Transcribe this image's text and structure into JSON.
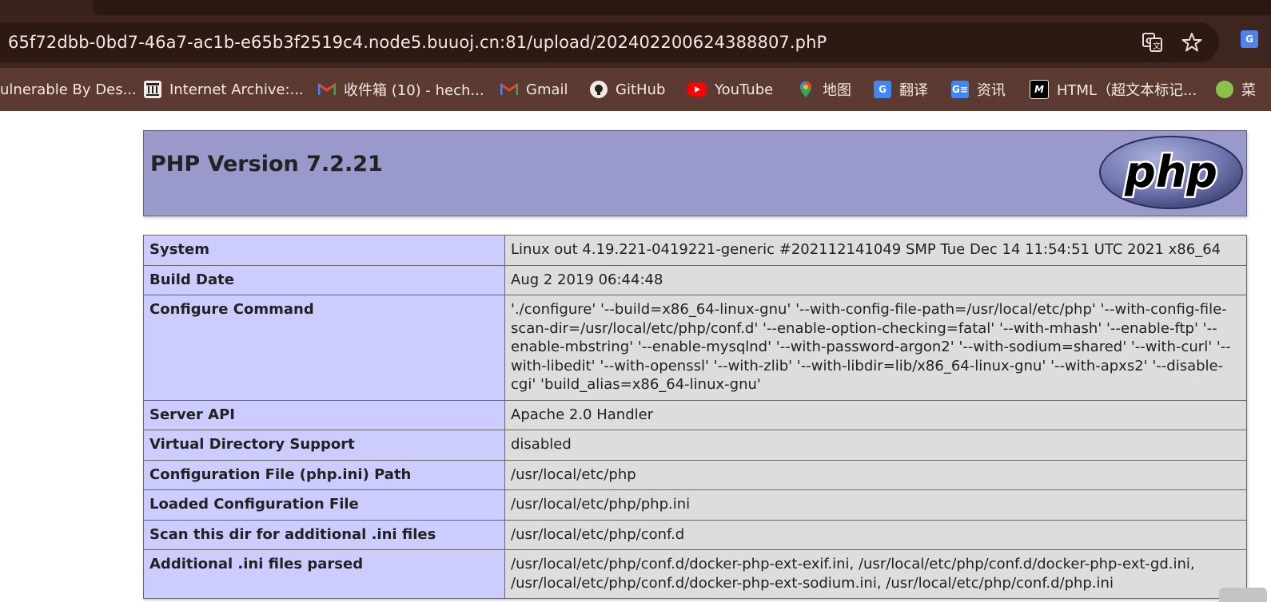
{
  "browser": {
    "url": "65f72dbb-0bd7-46a7-ac1b-e65b3f2519c4.node5.buuoj.cn:81/upload/202402200624388807.phP",
    "icons": {
      "translate": "translate-icon",
      "star": "bookmark-star-icon",
      "extension": "extension-icon"
    },
    "extension_letter": "G",
    "bookmarks": [
      {
        "label": "ulnerable By Des...",
        "icon": ""
      },
      {
        "label": "Internet Archive:...",
        "icon": "archive-icon"
      },
      {
        "label": "收件箱 (10) - hech...",
        "icon": "gmail-icon"
      },
      {
        "label": "Gmail",
        "icon": "gmail-icon"
      },
      {
        "label": "GitHub",
        "icon": "github-icon"
      },
      {
        "label": "YouTube",
        "icon": "youtube-icon"
      },
      {
        "label": "地图",
        "icon": "maps-icon"
      },
      {
        "label": "翻译",
        "icon": "translate-icon"
      },
      {
        "label": "资讯",
        "icon": "news-icon"
      },
      {
        "label": "HTML（超文本标记...",
        "icon": "mdn-icon"
      },
      {
        "label": "菜",
        "icon": ""
      }
    ]
  },
  "phpinfo": {
    "title": "PHP Version 7.2.21",
    "logo_text": "php",
    "rows": [
      {
        "key": "System",
        "value": "Linux out 4.19.221-0419221-generic #202112141049 SMP Tue Dec 14 11:54:51 UTC 2021 x86_64"
      },
      {
        "key": "Build Date",
        "value": "Aug 2 2019 06:44:48"
      },
      {
        "key": "Configure Command",
        "value": "'./configure' '--build=x86_64-linux-gnu' '--with-config-file-path=/usr/local/etc/php' '--with-config-file-scan-dir=/usr/local/etc/php/conf.d' '--enable-option-checking=fatal' '--with-mhash' '--enable-ftp' '--enable-mbstring' '--enable-mysqlnd' '--with-password-argon2' '--with-sodium=shared' '--with-curl' '--with-libedit' '--with-openssl' '--with-zlib' '--with-libdir=lib/x86_64-linux-gnu' '--with-apxs2' '--disable-cgi' 'build_alias=x86_64-linux-gnu'"
      },
      {
        "key": "Server API",
        "value": "Apache 2.0 Handler"
      },
      {
        "key": "Virtual Directory Support",
        "value": "disabled"
      },
      {
        "key": "Configuration File (php.ini) Path",
        "value": "/usr/local/etc/php"
      },
      {
        "key": "Loaded Configuration File",
        "value": "/usr/local/etc/php/php.ini"
      },
      {
        "key": "Scan this dir for additional .ini files",
        "value": "/usr/local/etc/php/conf.d"
      },
      {
        "key": "Additional .ini files parsed",
        "value": "/usr/local/etc/php/conf.d/docker-php-ext-exif.ini, /usr/local/etc/php/conf.d/docker-php-ext-gd.ini, /usr/local/etc/php/conf.d/docker-php-ext-sodium.ini, /usr/local/etc/php/conf.d/php.ini"
      }
    ]
  }
}
